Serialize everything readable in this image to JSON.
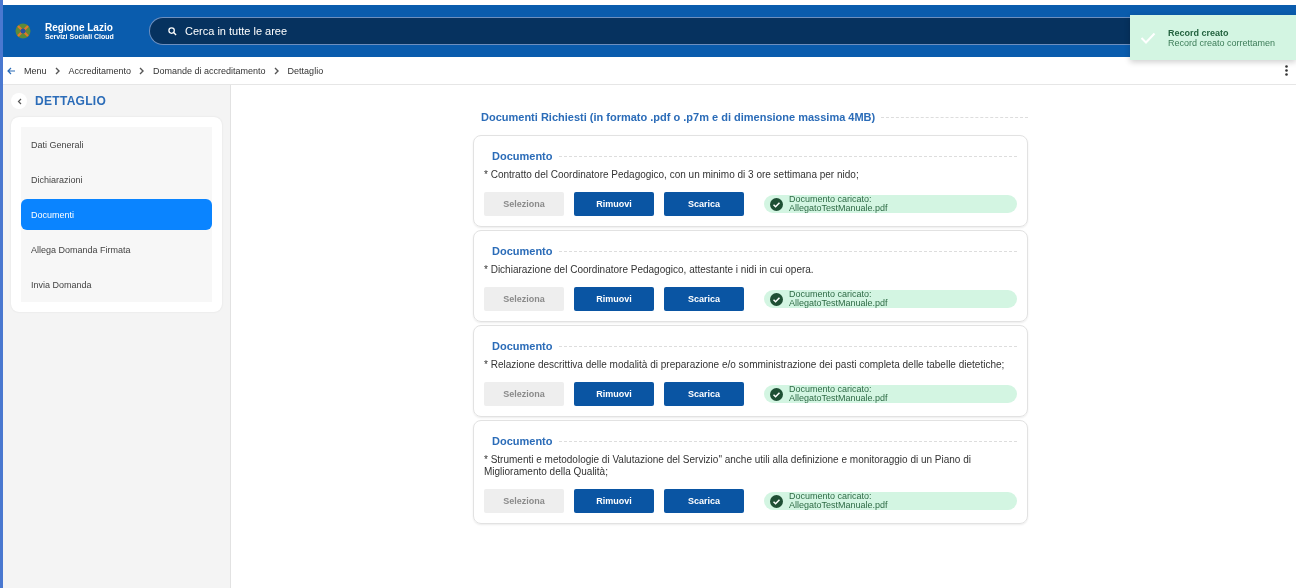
{
  "header": {
    "brand": "Regione Lazio",
    "subtitle": "Servizi Sociali Cloud",
    "search": {
      "placeholder": "Cerca in tutte le aree"
    }
  },
  "toast": {
    "title": "Record creato",
    "message": "Record creato correttamen"
  },
  "breadcrumb": [
    "Menu",
    "Accreditamento",
    "Domande di accreditamento",
    "Dettaglio"
  ],
  "sidebar": {
    "title": "DETTAGLIO",
    "items": [
      {
        "label": "Dati Generali",
        "selected": false
      },
      {
        "label": "Dichiarazioni",
        "selected": false
      },
      {
        "label": "Documenti",
        "selected": true
      },
      {
        "label": "Allega Domanda Firmata",
        "selected": false
      },
      {
        "label": "Invia Domanda",
        "selected": false
      }
    ]
  },
  "section_title": "Documenti Richiesti (in formato .pdf o .p7m e di dimensione massima 4MB)",
  "documents": [
    {
      "title": "Documento",
      "description": "* Contratto del Coordinatore Pedagogico, con un minimo di 3 ore settimana per nido;",
      "buttons": [
        {
          "label": "Seleziona",
          "disabled": true
        },
        {
          "label": "Rimuovi",
          "disabled": false
        },
        {
          "label": "Scarica",
          "disabled": false
        }
      ],
      "status": {
        "line1": "Documento caricato:",
        "line2": "AllegatoTestManuale.pdf"
      }
    },
    {
      "title": "Documento",
      "description": "* Dichiarazione del Coordinatore Pedagogico, attestante i nidi in cui opera.",
      "buttons": [
        {
          "label": "Seleziona",
          "disabled": true
        },
        {
          "label": "Rimuovi",
          "disabled": false
        },
        {
          "label": "Scarica",
          "disabled": false
        }
      ],
      "status": {
        "line1": "Documento caricato:",
        "line2": "AllegatoTestManuale.pdf"
      }
    },
    {
      "title": "Documento",
      "description": "* Relazione descrittiva delle modalità di preparazione e/o somministrazione dei pasti completa delle tabelle dietetiche;",
      "buttons": [
        {
          "label": "Seleziona",
          "disabled": true
        },
        {
          "label": "Rimuovi",
          "disabled": false
        },
        {
          "label": "Scarica",
          "disabled": false
        }
      ],
      "status": {
        "line1": "Documento caricato:",
        "line2": "AllegatoTestManuale.pdf"
      }
    },
    {
      "title": "Documento",
      "description": "* Strumenti e metodologie di Valutazione del Servizio\" anche utili alla definizione e monitoraggio di un Piano di Miglioramento della Qualità;",
      "buttons": [
        {
          "label": "Seleziona",
          "disabled": true
        },
        {
          "label": "Rimuovi",
          "disabled": false
        },
        {
          "label": "Scarica",
          "disabled": false
        }
      ],
      "status": {
        "line1": "Documento caricato:",
        "line2": "AllegatoTestManuale.pdf"
      }
    }
  ]
}
